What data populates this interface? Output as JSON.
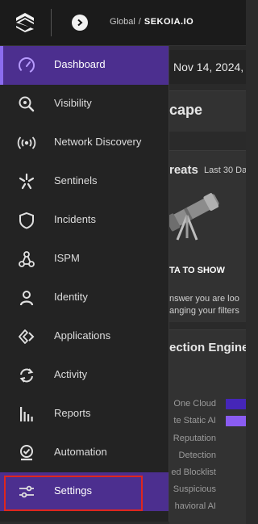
{
  "header": {
    "logo_icon": "sekoia-logo-icon",
    "expand_icon": "chevron-right-icon",
    "breadcrumb": {
      "scope": "Global",
      "separator": "/",
      "tenant": "SEKOIA.IO"
    }
  },
  "sidebar": {
    "items": [
      {
        "label": "Dashboard",
        "icon": "gauge-icon",
        "state": "active"
      },
      {
        "label": "Visibility",
        "icon": "magnifier-icon",
        "state": "normal"
      },
      {
        "label": "Network Discovery",
        "icon": "broadcast-icon",
        "state": "normal"
      },
      {
        "label": "Sentinels",
        "icon": "sentinel-icon",
        "state": "normal"
      },
      {
        "label": "Incidents",
        "icon": "shield-icon",
        "state": "normal"
      },
      {
        "label": "ISPM",
        "icon": "graph-nodes-icon",
        "state": "normal"
      },
      {
        "label": "Identity",
        "icon": "user-icon",
        "state": "normal"
      },
      {
        "label": "Applications",
        "icon": "applications-icon",
        "state": "normal"
      },
      {
        "label": "Activity",
        "icon": "refresh-icon",
        "state": "normal"
      },
      {
        "label": "Reports",
        "icon": "bar-chart-icon",
        "state": "normal"
      },
      {
        "label": "Automation",
        "icon": "automation-icon",
        "state": "normal"
      },
      {
        "label": "Settings",
        "icon": "sliders-icon",
        "state": "highlighted"
      }
    ]
  },
  "main": {
    "date_range": "Nov 14, 2024, 4",
    "landscape_title": "cape",
    "threats_card": {
      "title": "reats",
      "range": "Last 30 Da",
      "image_icon": "telescope-icon",
      "empty_message": "TA TO SHOW",
      "hint_line1": "nswer you are loo",
      "hint_line2": "anging your filters"
    },
    "engines_card": {
      "title": "ection Engine",
      "rows": [
        {
          "label": "One Cloud",
          "bar_color": "#4526b8",
          "value_fraction": 0.7
        },
        {
          "label": "te Static AI",
          "bar_color": "#8a5cf2",
          "value_fraction": 0.7
        },
        {
          "label": "Reputation",
          "bar_color": "",
          "value_fraction": 0
        },
        {
          "label": "Detection",
          "bar_color": "",
          "value_fraction": 0
        },
        {
          "label": "ed Blocklist",
          "bar_color": "",
          "value_fraction": 0
        },
        {
          "label": "Suspicious",
          "bar_color": "",
          "value_fraction": 0
        },
        {
          "label": "havioral AI",
          "bar_color": "",
          "value_fraction": 0
        }
      ]
    }
  },
  "colors": {
    "accent": "#4c2f8f",
    "accent_bar": "#8b6cf0",
    "focus_outline": "#e0261d"
  }
}
